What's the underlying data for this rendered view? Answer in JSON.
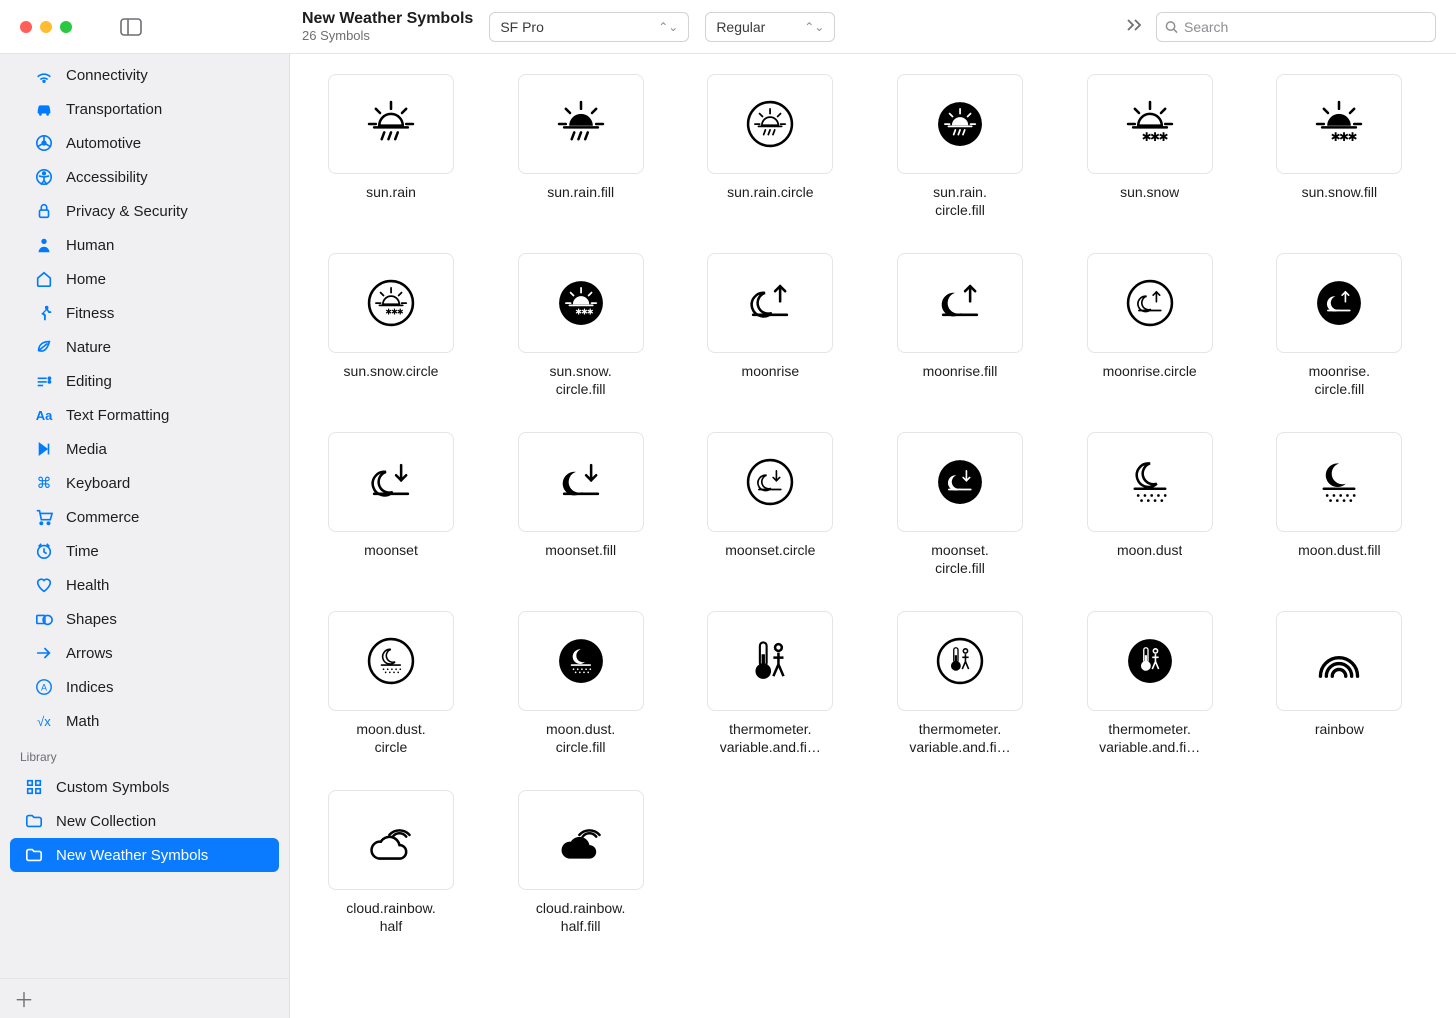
{
  "header": {
    "title": "New Weather Symbols",
    "subtitle": "26 Symbols",
    "font": "SF Pro",
    "weight": "Regular",
    "search_placeholder": "Search"
  },
  "sidebar": {
    "categories": [
      {
        "icon": "connectivity",
        "label": "Connectivity"
      },
      {
        "icon": "transportation",
        "label": "Transportation"
      },
      {
        "icon": "automotive",
        "label": "Automotive"
      },
      {
        "icon": "accessibility",
        "label": "Accessibility"
      },
      {
        "icon": "privacy",
        "label": "Privacy & Security"
      },
      {
        "icon": "human",
        "label": "Human"
      },
      {
        "icon": "home",
        "label": "Home"
      },
      {
        "icon": "fitness",
        "label": "Fitness"
      },
      {
        "icon": "nature",
        "label": "Nature"
      },
      {
        "icon": "editing",
        "label": "Editing"
      },
      {
        "icon": "text",
        "label": "Text Formatting"
      },
      {
        "icon": "media",
        "label": "Media"
      },
      {
        "icon": "keyboard",
        "label": "Keyboard"
      },
      {
        "icon": "commerce",
        "label": "Commerce"
      },
      {
        "icon": "time",
        "label": "Time"
      },
      {
        "icon": "health",
        "label": "Health"
      },
      {
        "icon": "shapes",
        "label": "Shapes"
      },
      {
        "icon": "arrows",
        "label": "Arrows"
      },
      {
        "icon": "indices",
        "label": "Indices"
      },
      {
        "icon": "math",
        "label": "Math"
      }
    ],
    "library_header": "Library",
    "library": [
      {
        "icon": "custom",
        "label": "Custom Symbols",
        "selected": false
      },
      {
        "icon": "folder",
        "label": "New Collection",
        "selected": false
      },
      {
        "icon": "folder",
        "label": "New Weather Symbols",
        "selected": true
      }
    ]
  },
  "symbols": [
    {
      "name": "sun.rain",
      "icon": "sun.rain"
    },
    {
      "name": "sun.rain.fill",
      "icon": "sun.rain.fill"
    },
    {
      "name": "sun.rain.circle",
      "icon": "sun.rain.circle"
    },
    {
      "name": "sun.rain. circle.fill",
      "icon": "sun.rain.circle.fill"
    },
    {
      "name": "sun.snow",
      "icon": "sun.snow"
    },
    {
      "name": "sun.snow.fill",
      "icon": "sun.snow.fill"
    },
    {
      "name": "sun.snow.circle",
      "icon": "sun.snow.circle"
    },
    {
      "name": "sun.snow. circle.fill",
      "icon": "sun.snow.circle.fill"
    },
    {
      "name": "moonrise",
      "icon": "moonrise"
    },
    {
      "name": "moonrise.fill",
      "icon": "moonrise.fill"
    },
    {
      "name": "moonrise.circle",
      "icon": "moonrise.circle"
    },
    {
      "name": "moonrise. circle.fill",
      "icon": "moonrise.circle.fill"
    },
    {
      "name": "moonset",
      "icon": "moonset"
    },
    {
      "name": "moonset.fill",
      "icon": "moonset.fill"
    },
    {
      "name": "moonset.circle",
      "icon": "moonset.circle"
    },
    {
      "name": "moonset. circle.fill",
      "icon": "moonset.circle.fill"
    },
    {
      "name": "moon.dust",
      "icon": "moon.dust"
    },
    {
      "name": "moon.dust.fill",
      "icon": "moon.dust.fill"
    },
    {
      "name": "moon.dust. circle",
      "icon": "moon.dust.circle"
    },
    {
      "name": "moon.dust. circle.fill",
      "icon": "moon.dust.circle.fill"
    },
    {
      "name": "thermometer. variable.and.fi…",
      "icon": "thermometer"
    },
    {
      "name": "thermometer. variable.and.fi…",
      "icon": "thermometer.circle"
    },
    {
      "name": "thermometer. variable.and.fi…",
      "icon": "thermometer.circle.fill"
    },
    {
      "name": "rainbow",
      "icon": "rainbow"
    },
    {
      "name": "cloud.rainbow. half",
      "icon": "cloud.rainbow"
    },
    {
      "name": "cloud.rainbow. half.fill",
      "icon": "cloud.rainbow.fill"
    }
  ]
}
